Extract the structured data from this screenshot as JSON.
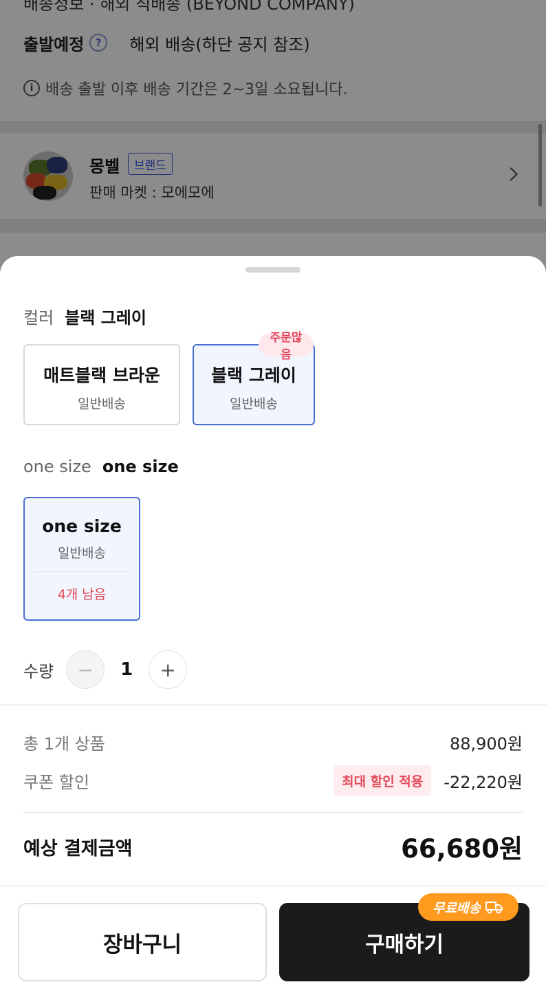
{
  "background": {
    "cut_row_text": "배송정보 · 해외 직배송 (BEYOND COMPANY)",
    "departure_label": "출발예정",
    "departure_value": "해외 배송(하단 공지 참조)",
    "shipping_notice": "배송 출발 이후 배송 기간은 2~3일 소요됩니다.",
    "seller": {
      "name": "몽벨",
      "badge": "브랜드",
      "market": "판매 마켓 : 모에모에"
    }
  },
  "sheet": {
    "color_option": {
      "name": "컬러",
      "selected": "블랙 그레이",
      "choices": [
        {
          "label": "매트블랙 브라운",
          "sub": "일반배송"
        },
        {
          "label": "블랙 그레이",
          "sub": "일반배송",
          "badge": "주문많음"
        }
      ]
    },
    "size_option": {
      "name": "one size",
      "selected": "one size",
      "choices": [
        {
          "label": "one size",
          "sub": "일반배송",
          "stock": "4개 남음"
        }
      ]
    },
    "quantity": {
      "label": "수량",
      "value": "1",
      "minus": "−",
      "plus": "+"
    },
    "summary": {
      "items_label": "총 1개 상품",
      "items_value": "88,900원",
      "coupon_label": "쿠폰 할인",
      "coupon_badge": "최대 할인 적용",
      "coupon_value": "-22,220원",
      "total_label": "예상 결제금액",
      "total_value": "66,680원"
    },
    "actions": {
      "cart": "장바구니",
      "buy": "구매하기",
      "free_shipping": "무료배송"
    }
  },
  "icons": [
    "question-icon",
    "info-icon",
    "chevron-right-icon",
    "minus-icon",
    "plus-icon",
    "truck-icon"
  ],
  "colors": {
    "accent_blue": "#4a6fd1",
    "alert_red": "#e24a5a",
    "buy_button": "#1b1b1b",
    "free_shipping_badge": "#ff9a1f"
  }
}
